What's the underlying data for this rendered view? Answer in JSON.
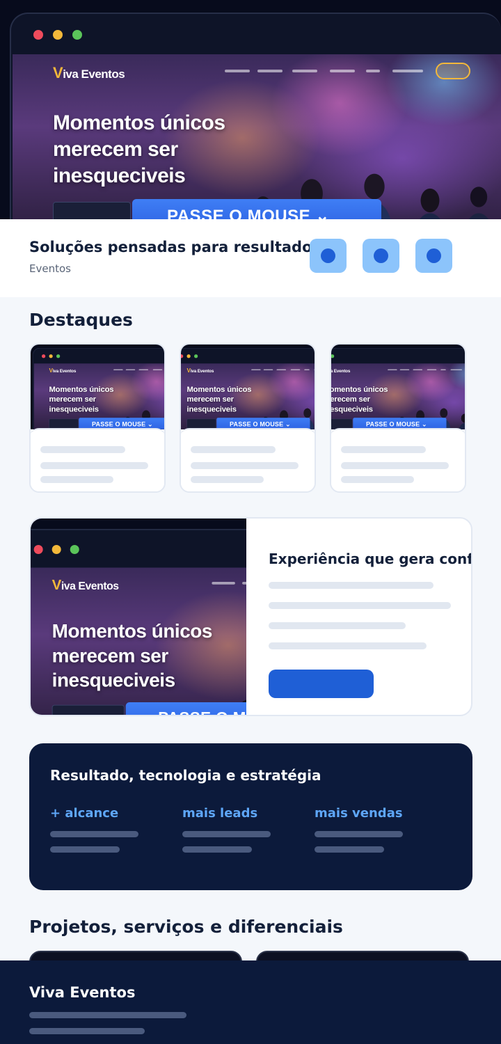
{
  "hero": {
    "logo_mark": "V",
    "logo_text": "iva Eventos",
    "headline": "Momentos únicos merecem ser inesqueciveis",
    "cta_label": "PASSE O MOUSE ⌄"
  },
  "solutions": {
    "title": "Soluções pensadas para resultados",
    "subtitle": "Eventos"
  },
  "highlights": {
    "title": "Destaques"
  },
  "feature": {
    "title": "Experiência que gera confiança"
  },
  "results": {
    "title": "Resultado, tecnologia e estratégia",
    "stats": [
      "+ alcance",
      "mais leads",
      "mais vendas"
    ]
  },
  "projects": {
    "title": "Projetos, serviços e diferenciais"
  },
  "footer": {
    "brand": "Viva Eventos"
  },
  "colors": {
    "primary": "#1f5fd6",
    "dark_navy": "#0c1a3b",
    "accent_light_blue": "#5ea6f7",
    "chip_blue": "#8cc4fb",
    "brand_gold": "#f3b83a"
  }
}
